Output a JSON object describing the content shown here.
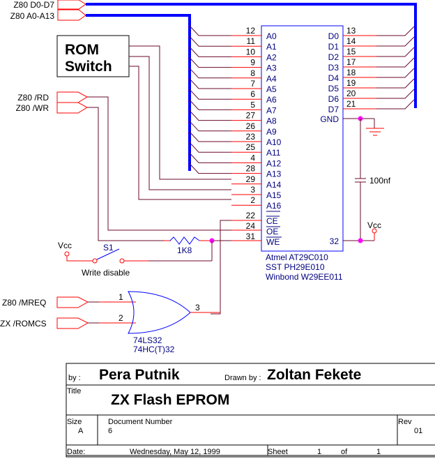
{
  "schematic": {
    "ports": {
      "data_bus": "Z80 D0-D7",
      "addr_bus": "Z80 A0-A13",
      "rd": "Z80 /RD",
      "wr": "Z80 /WR",
      "mreq": "Z80 /MREQ",
      "romcs": "ZX /ROMCS"
    },
    "rom_switch": {
      "line1": "ROM",
      "line2": "Switch"
    },
    "chip": {
      "left_pins": [
        {
          "num": "12",
          "name": "A0"
        },
        {
          "num": "11",
          "name": "A1"
        },
        {
          "num": "10",
          "name": "A2"
        },
        {
          "num": "9",
          "name": "A3"
        },
        {
          "num": "8",
          "name": "A4"
        },
        {
          "num": "7",
          "name": "A5"
        },
        {
          "num": "6",
          "name": "A6"
        },
        {
          "num": "5",
          "name": "A7"
        },
        {
          "num": "27",
          "name": "A8"
        },
        {
          "num": "26",
          "name": "A9"
        },
        {
          "num": "23",
          "name": "A10"
        },
        {
          "num": "25",
          "name": "A11"
        },
        {
          "num": "4",
          "name": "A12"
        },
        {
          "num": "28",
          "name": "A13"
        },
        {
          "num": "29",
          "name": "A14"
        },
        {
          "num": "3",
          "name": "A15"
        },
        {
          "num": "2",
          "name": "A16"
        }
      ],
      "right_pins": [
        {
          "num": "13",
          "name": "D0"
        },
        {
          "num": "14",
          "name": "D1"
        },
        {
          "num": "15",
          "name": "D2"
        },
        {
          "num": "17",
          "name": "D3"
        },
        {
          "num": "18",
          "name": "D4"
        },
        {
          "num": "19",
          "name": "D5"
        },
        {
          "num": "20",
          "name": "D6"
        },
        {
          "num": "21",
          "name": "D7"
        }
      ],
      "gnd": {
        "name": "GND"
      },
      "ctrl_pins": [
        {
          "num": "22",
          "name": "CE"
        },
        {
          "num": "24",
          "name": "OE"
        },
        {
          "num": "31",
          "name": "WE"
        }
      ],
      "vcc_pin": {
        "num": "32"
      },
      "parts": [
        "Atmel AT29C010",
        "SST PH29E010",
        "Winbond W29EE011"
      ]
    },
    "capacitor": "100nf",
    "vcc_label": "Vcc",
    "resistor": "1K8",
    "switch": {
      "ref": "S1",
      "label": "Write disable"
    },
    "gate": {
      "pin1": "1",
      "pin2": "2",
      "pin3": "3",
      "parts": [
        "74LS32",
        "74HC(T)32"
      ]
    }
  },
  "title_block": {
    "by_label": "by :",
    "by_value": "Pera Putnik",
    "drawn_label": "Drawn by :",
    "drawn_value": "Zoltan Fekete",
    "title_label": "Title",
    "title_value": "ZX Flash EPROM",
    "size_label": "Size",
    "size_value": "A",
    "docnum_label": "Document Number",
    "docnum_value": "6",
    "rev_label": "Rev",
    "rev_value": "01",
    "date_label": "Date:",
    "date_value": "Wednesday, May 12, 1999",
    "sheet_label": "Sheet",
    "sheet_value": "1",
    "of_label": "of",
    "of_value": "1"
  }
}
